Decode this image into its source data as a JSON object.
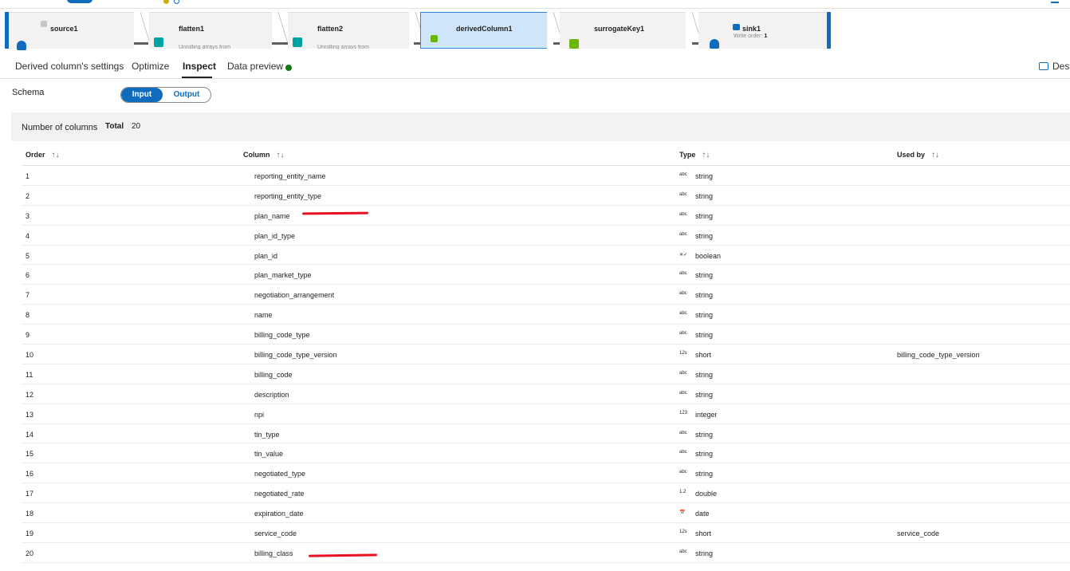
{
  "pipeline": {
    "nodes": [
      {
        "name": "source1",
        "subtitle": ""
      },
      {
        "name": "flatten1",
        "subtitle": "Unrolling arrays from"
      },
      {
        "name": "flatten2",
        "subtitle": "Unrolling arrays from"
      },
      {
        "name": "derivedColumn1",
        "subtitle": ""
      },
      {
        "name": "surrogateKey1",
        "subtitle": ""
      },
      {
        "name": "sink1",
        "subtitle_prefix": "Write order:",
        "subtitle_value": "1"
      }
    ]
  },
  "tabs": [
    {
      "label": "Derived column's settings"
    },
    {
      "label": "Optimize"
    },
    {
      "label": "Inspect"
    },
    {
      "label": "Data preview"
    }
  ],
  "active_tab": "Inspect",
  "description_button": "Desc",
  "colors": {
    "accent": "#0f6cbd",
    "status_dot": "#107c10",
    "annotation": "#e81123"
  },
  "schema": {
    "label": "Schema",
    "toggle": {
      "input": "Input",
      "output": "Output",
      "selected": "Input"
    }
  },
  "column_count": {
    "label": "Number of columns",
    "total_label": "Total",
    "total": "20"
  },
  "table": {
    "headers": {
      "order": "Order",
      "column": "Column",
      "type": "Type",
      "used_by": "Used by"
    },
    "sort_glyph": "↑↓",
    "rows": [
      {
        "order": "1",
        "column": "reporting_entity_name",
        "type_icon": "abc",
        "type": "string",
        "used_by": ""
      },
      {
        "order": "2",
        "column": "reporting_entity_type",
        "type_icon": "abc",
        "type": "string",
        "used_by": ""
      },
      {
        "order": "3",
        "column": "plan_name",
        "type_icon": "abc",
        "type": "string",
        "used_by": ""
      },
      {
        "order": "4",
        "column": "plan_id_type",
        "type_icon": "abc",
        "type": "string",
        "used_by": ""
      },
      {
        "order": "5",
        "column": "plan_id",
        "type_icon": "✕✓",
        "type": "boolean",
        "used_by": ""
      },
      {
        "order": "6",
        "column": "plan_market_type",
        "type_icon": "abc",
        "type": "string",
        "used_by": ""
      },
      {
        "order": "7",
        "column": "negotiation_arrangement",
        "type_icon": "abc",
        "type": "string",
        "used_by": ""
      },
      {
        "order": "8",
        "column": "name",
        "type_icon": "abc",
        "type": "string",
        "used_by": ""
      },
      {
        "order": "9",
        "column": "billing_code_type",
        "type_icon": "abc",
        "type": "string",
        "used_by": ""
      },
      {
        "order": "10",
        "column": "billing_code_type_version",
        "type_icon": "12s",
        "type": "short",
        "used_by": "billing_code_type_version"
      },
      {
        "order": "11",
        "column": "billing_code",
        "type_icon": "abc",
        "type": "string",
        "used_by": ""
      },
      {
        "order": "12",
        "column": "description",
        "type_icon": "abc",
        "type": "string",
        "used_by": ""
      },
      {
        "order": "13",
        "column": "npi",
        "type_icon": "123",
        "type": "integer",
        "used_by": ""
      },
      {
        "order": "14",
        "column": "tin_type",
        "type_icon": "abc",
        "type": "string",
        "used_by": ""
      },
      {
        "order": "15",
        "column": "tin_value",
        "type_icon": "abc",
        "type": "string",
        "used_by": ""
      },
      {
        "order": "16",
        "column": "negotiated_type",
        "type_icon": "abc",
        "type": "string",
        "used_by": ""
      },
      {
        "order": "17",
        "column": "negotiated_rate",
        "type_icon": "1.2",
        "type": "double",
        "used_by": ""
      },
      {
        "order": "18",
        "column": "expiration_date",
        "type_icon": "📅",
        "type": "date",
        "used_by": ""
      },
      {
        "order": "19",
        "column": "service_code",
        "type_icon": "12s",
        "type": "short",
        "used_by": "service_code"
      },
      {
        "order": "20",
        "column": "billing_class",
        "type_icon": "abc",
        "type": "string",
        "used_by": ""
      }
    ]
  }
}
